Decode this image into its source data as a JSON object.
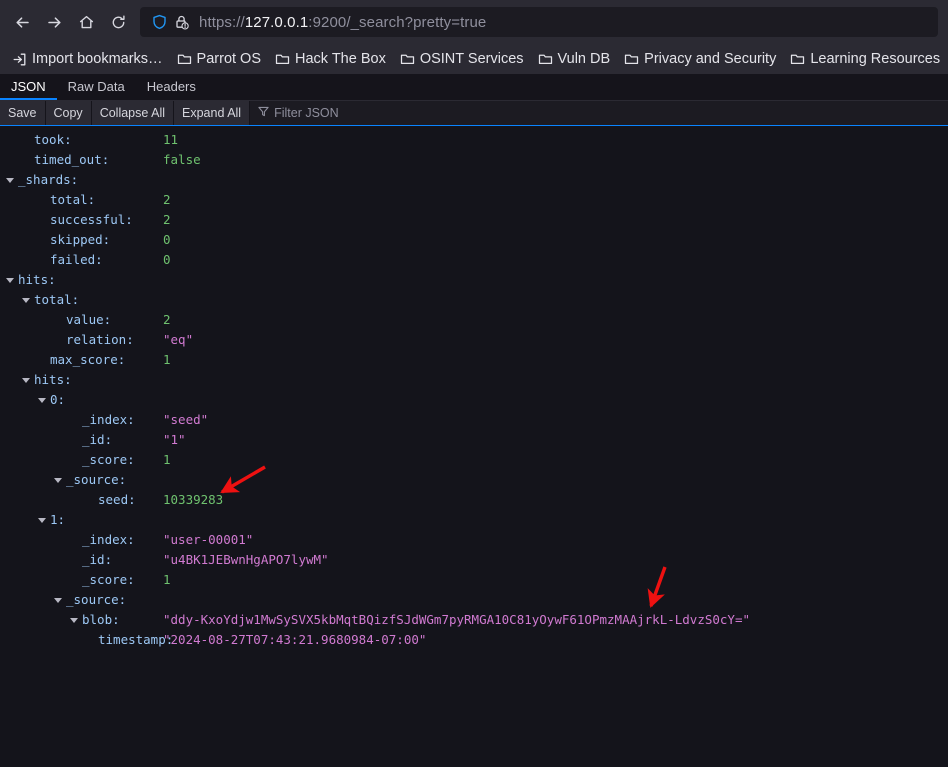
{
  "browser": {
    "nav": {
      "back_label": "Back",
      "forward_label": "Forward",
      "home_label": "Home",
      "reload_label": "Reload"
    },
    "url": {
      "scheme_prefix": "https://",
      "host": "127.0.0.1",
      "rest": ":9200/_search?pretty=true",
      "full": "https://127.0.0.1:9200/_search?pretty=true",
      "shield_icon": "shield-icon",
      "lock_warning_icon": "lock-warning-icon"
    },
    "bookmarks": [
      {
        "label": "Import bookmarks…",
        "icon": "import-icon"
      },
      {
        "label": "Parrot OS",
        "icon": "folder-icon"
      },
      {
        "label": "Hack The Box",
        "icon": "folder-icon"
      },
      {
        "label": "OSINT Services",
        "icon": "folder-icon"
      },
      {
        "label": "Vuln DB",
        "icon": "folder-icon"
      },
      {
        "label": "Privacy and Security",
        "icon": "folder-icon"
      },
      {
        "label": "Learning Resources",
        "icon": "folder-icon"
      }
    ]
  },
  "viewer": {
    "tabs": [
      {
        "label": "JSON",
        "active": true
      },
      {
        "label": "Raw Data",
        "active": false
      },
      {
        "label": "Headers",
        "active": false
      }
    ],
    "toolbar": {
      "save_label": "Save",
      "copy_label": "Copy",
      "collapse_all_label": "Collapse All",
      "expand_all_label": "Expand All",
      "filter_placeholder": "Filter JSON",
      "filter_icon": "funnel-icon"
    },
    "accent_color": "#0a84ff"
  },
  "json": {
    "rows": [
      {
        "indent": 1,
        "twisty": "",
        "key": "took",
        "value": "11",
        "type": "num"
      },
      {
        "indent": 1,
        "twisty": "",
        "key": "timed_out",
        "value": "false",
        "type": "bool"
      },
      {
        "indent": 0,
        "twisty": "open",
        "key": "_shards",
        "value": "",
        "type": "none"
      },
      {
        "indent": 2,
        "twisty": "",
        "key": "total",
        "value": "2",
        "type": "num"
      },
      {
        "indent": 2,
        "twisty": "",
        "key": "successful",
        "value": "2",
        "type": "num"
      },
      {
        "indent": 2,
        "twisty": "",
        "key": "skipped",
        "value": "0",
        "type": "num"
      },
      {
        "indent": 2,
        "twisty": "",
        "key": "failed",
        "value": "0",
        "type": "num"
      },
      {
        "indent": 0,
        "twisty": "open",
        "key": "hits",
        "value": "",
        "type": "none"
      },
      {
        "indent": 1,
        "twisty": "open",
        "key": "total",
        "value": "",
        "type": "none"
      },
      {
        "indent": 3,
        "twisty": "",
        "key": "value",
        "value": "2",
        "type": "num"
      },
      {
        "indent": 3,
        "twisty": "",
        "key": "relation",
        "value": "\"eq\"",
        "type": "str"
      },
      {
        "indent": 2,
        "twisty": "",
        "key": "max_score",
        "value": "1",
        "type": "num"
      },
      {
        "indent": 1,
        "twisty": "open",
        "key": "hits",
        "value": "",
        "type": "none"
      },
      {
        "indent": 2,
        "twisty": "open",
        "key": "0",
        "value": "",
        "type": "none"
      },
      {
        "indent": 4,
        "twisty": "",
        "key": "_index",
        "value": "\"seed\"",
        "type": "str"
      },
      {
        "indent": 4,
        "twisty": "",
        "key": "_id",
        "value": "\"1\"",
        "type": "str"
      },
      {
        "indent": 4,
        "twisty": "",
        "key": "_score",
        "value": "1",
        "type": "num"
      },
      {
        "indent": 3,
        "twisty": "open",
        "key": "_source",
        "value": "",
        "type": "none"
      },
      {
        "indent": 5,
        "twisty": "",
        "key": "seed",
        "value": "10339283",
        "type": "num"
      },
      {
        "indent": 2,
        "twisty": "open",
        "key": "1",
        "value": "",
        "type": "none"
      },
      {
        "indent": 4,
        "twisty": "",
        "key": "_index",
        "value": "\"user-00001\"",
        "type": "str"
      },
      {
        "indent": 4,
        "twisty": "",
        "key": "_id",
        "value": "\"u4BK1JEBwnHgAPO7lywM\"",
        "type": "str"
      },
      {
        "indent": 4,
        "twisty": "",
        "key": "_score",
        "value": "1",
        "type": "num"
      },
      {
        "indent": 3,
        "twisty": "open",
        "key": "_source",
        "value": "",
        "type": "none"
      },
      {
        "indent": 4,
        "twisty": "open",
        "key": "blob",
        "value": "\"ddy-KxoYdjw1MwSySVX5kbMqtBQizfSJdWGm7pyRMGA10C81yOywF61OPmzMAAjrkL-LdvzS0cY=\"",
        "type": "str"
      },
      {
        "indent": 5,
        "twisty": "",
        "key": "timestamp",
        "value": "\"2024-08-27T07:43:21.9680984-07:00\"",
        "type": "str"
      }
    ]
  },
  "annotations": [
    {
      "name": "arrow-to-seed-value",
      "color": "#ee1111"
    },
    {
      "name": "arrow-to-blob-value",
      "color": "#ee1111"
    }
  ]
}
